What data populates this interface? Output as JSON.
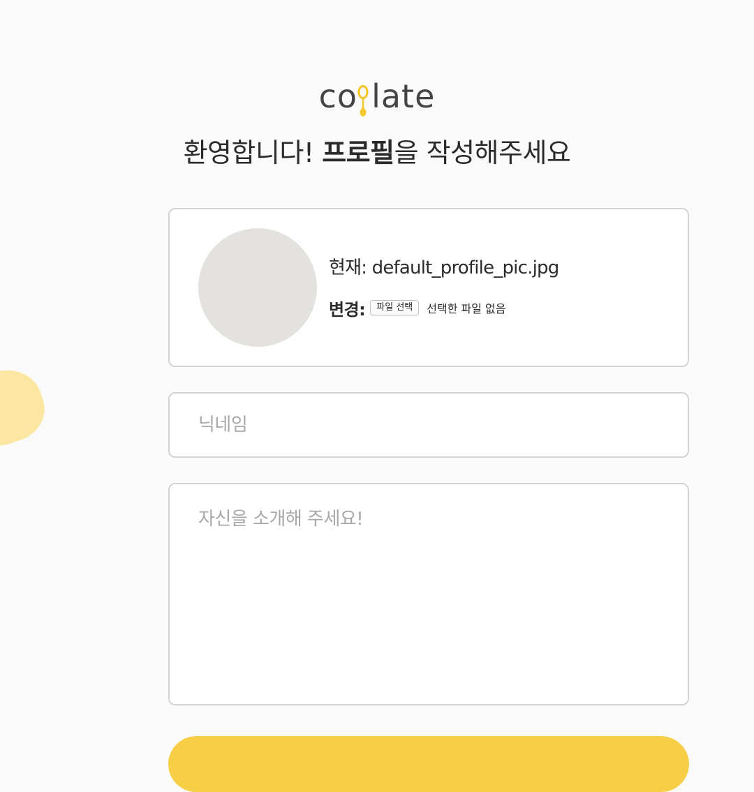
{
  "logo": {
    "text_before": "co",
    "text_after": "late"
  },
  "title": {
    "prefix": "환영합니다! ",
    "bold": "프로필",
    "suffix": "을 작성해주세요"
  },
  "profile": {
    "current_label": "현재: ",
    "current_file": "default_profile_pic.jpg",
    "change_label": "변경:",
    "file_button_label": "파일 선택",
    "file_status": "선택한 파일 없음"
  },
  "nickname": {
    "placeholder": "닉네임",
    "value": ""
  },
  "introduction": {
    "placeholder": "자신을 소개해 주세요!",
    "value": ""
  },
  "submit": {
    "label": ""
  },
  "colors": {
    "accent": "#f7ce46",
    "decoration": "#fbe7a1",
    "avatar_placeholder": "#e3e2df",
    "border": "#d4d4d4",
    "placeholder_text": "#a8a8a8"
  }
}
